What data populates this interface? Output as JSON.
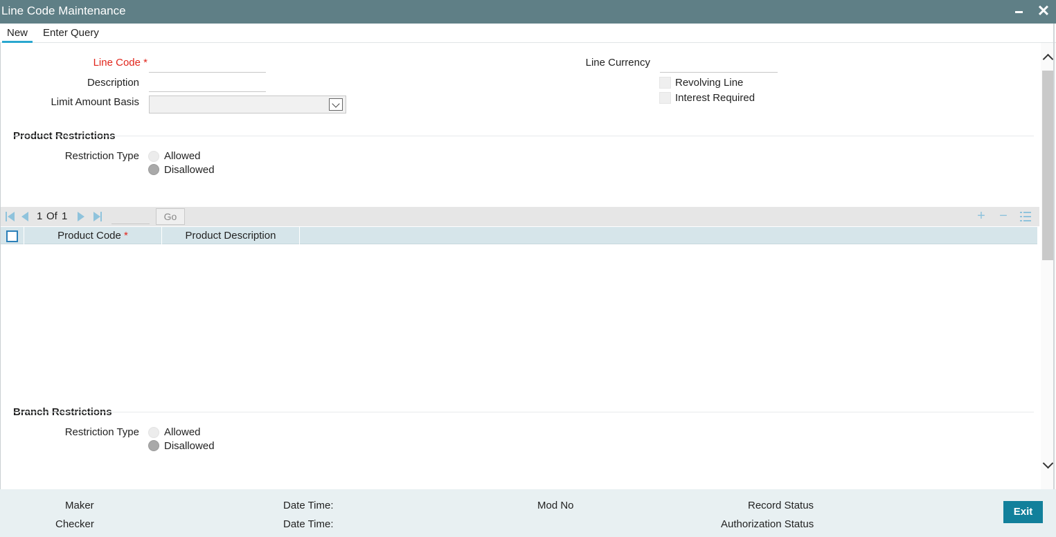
{
  "window": {
    "title": "Line Code Maintenance"
  },
  "tabs": {
    "new": "New",
    "enter_query": "Enter Query"
  },
  "form": {
    "line_code_label": "Line Code",
    "required_mark": "*",
    "description_label": "Description",
    "limit_amount_basis_label": "Limit Amount Basis",
    "line_currency_label": "Line Currency",
    "revolving_line_label": "Revolving Line",
    "interest_required_label": "Interest Required",
    "line_code_value": "",
    "description_value": "",
    "line_currency_value": "",
    "limit_amount_basis_value": ""
  },
  "product_restrictions": {
    "title": "Product Restrictions",
    "restriction_type_label": "Restriction Type",
    "allowed": "Allowed",
    "disallowed": "Disallowed",
    "selected": "Disallowed"
  },
  "grid": {
    "page_current": "1",
    "page_of": "Of",
    "page_total": "1",
    "go": "Go",
    "columns": [
      "Product Code",
      "Product Description"
    ],
    "rows": []
  },
  "branch_restrictions": {
    "title": "Branch Restrictions",
    "restriction_type_label": "Restriction Type",
    "allowed": "Allowed",
    "disallowed": "Disallowed",
    "selected": "Disallowed"
  },
  "footer": {
    "maker": "Maker",
    "checker": "Checker",
    "date_time_1": "Date Time:",
    "date_time_2": "Date Time:",
    "mod_no": "Mod No",
    "record_status": "Record Status",
    "authorization_status": "Authorization Status",
    "exit": "Exit"
  },
  "icons": {
    "first": "first-page-icon",
    "prev": "prev-page-icon",
    "next": "next-page-icon",
    "last": "last-page-icon",
    "add": "add-row-icon",
    "delete": "delete-row-icon",
    "view": "single-view-icon"
  },
  "colors": {
    "titlebar": "#5f7f86",
    "accent": "#2aa7cf",
    "required": "#e1251b",
    "exit_button": "#12809b",
    "grid_header": "#d6e5ea"
  }
}
